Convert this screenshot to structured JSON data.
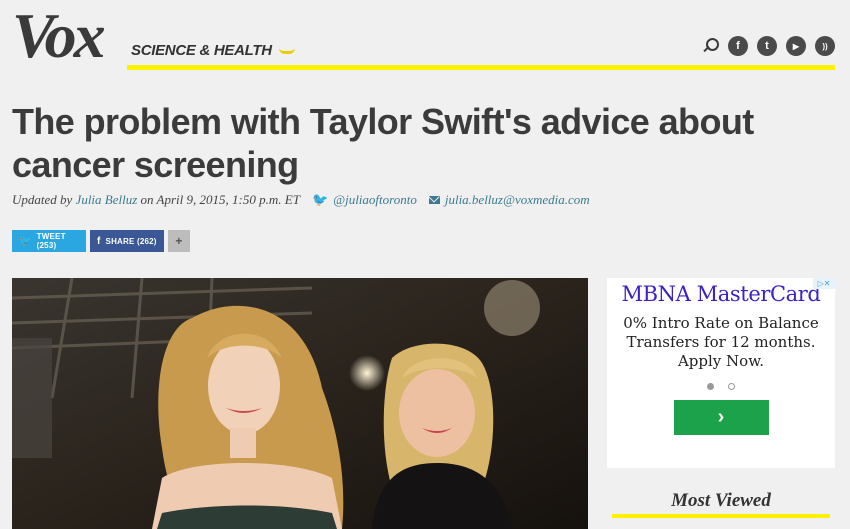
{
  "header": {
    "logo": "Vox",
    "section": "SCIENCE & HEALTH",
    "icons": [
      "search-icon",
      "facebook-icon",
      "twitter-icon",
      "youtube-icon",
      "rss-icon"
    ],
    "social_glyphs": {
      "facebook": "f",
      "twitter": "t",
      "youtube": "▶",
      "rss": "))"
    }
  },
  "article": {
    "headline": "The problem with Taylor Swift's advice about cancer screening",
    "byline": {
      "prefix": "Updated by",
      "author": "Julia Belluz",
      "date_text": "on April 9, 2015, 1:50 p.m. ET",
      "twitter_handle": "@juliaoftoronto",
      "email": "julia.belluz@voxmedia.com"
    },
    "share": {
      "tweet_label": "TWEET (253)",
      "share_label": "SHARE (262)",
      "more_label": "+"
    }
  },
  "ad": {
    "title": "MBNA MasterCard",
    "body": "0% Intro Rate on Balance Transfers for 12 months. Apply Now.",
    "cta_glyph": "›",
    "choices_glyph": "▷✕",
    "dots": 2,
    "active_dot": 1
  },
  "sidebar": {
    "most_viewed_title": "Most Viewed"
  },
  "colors": {
    "accent_yellow": "#fff200",
    "link": "#3b7a8f",
    "twitter": "#2aa7e0",
    "facebook": "#3a5896",
    "ad_title": "#3a22c8",
    "ad_cta": "#1ca24a"
  }
}
